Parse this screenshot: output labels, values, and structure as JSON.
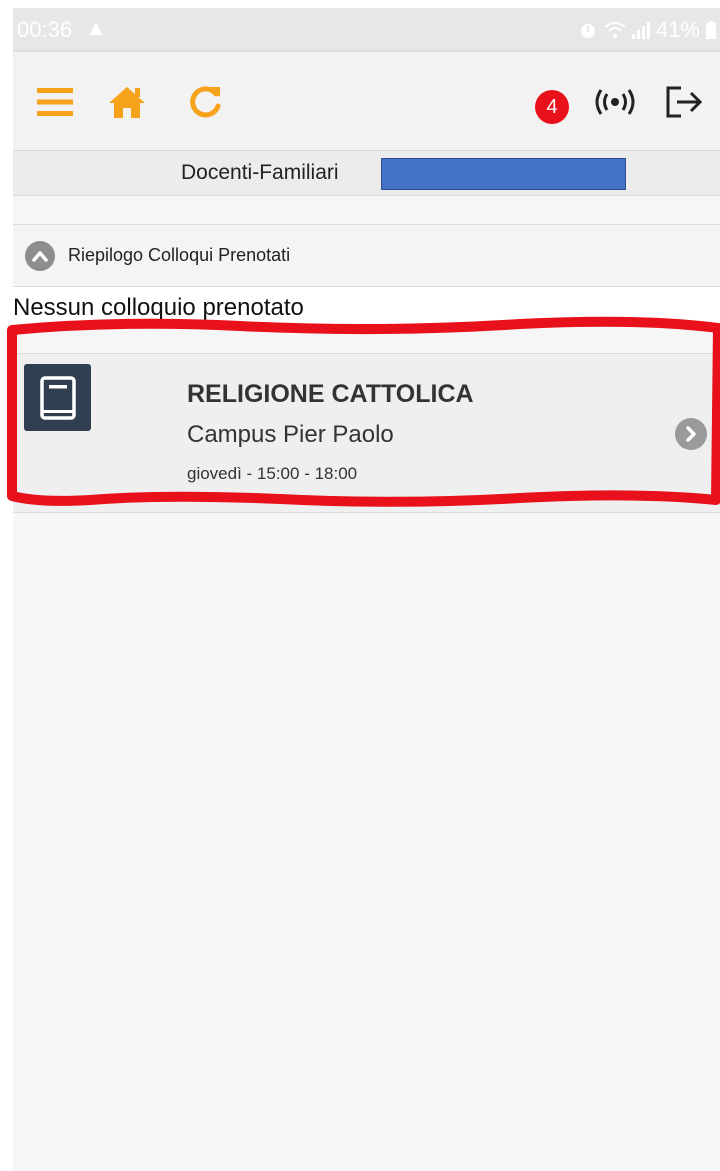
{
  "status_bar": {
    "time": "00:36",
    "battery": "41%",
    "icons": [
      "warning-icon",
      "alarm-icon",
      "wifi-icon",
      "signal-icon",
      "battery-icon"
    ]
  },
  "header": {
    "left_icons": [
      "menu-icon",
      "home-icon",
      "refresh-icon"
    ],
    "notification_count": "4",
    "right_icons": [
      "broadcast-icon",
      "logout-icon"
    ],
    "accent_color": "#f7a21b"
  },
  "title_bar": {
    "title": "Docenti-Familiari"
  },
  "section": {
    "label": "Riepilogo Colloqui Prenotati"
  },
  "empty_message": "Nessun colloquio prenotato",
  "items": [
    {
      "subject": "RELIGIONE CATTOLICA",
      "teacher": "Campus Pier Paolo",
      "schedule": "giovedì - 15:00 - 18:00",
      "icon": "book-icon"
    }
  ],
  "colors": {
    "notification_badge": "#e8101a",
    "redaction": "#4472c4",
    "annotation": "#e8101a"
  }
}
